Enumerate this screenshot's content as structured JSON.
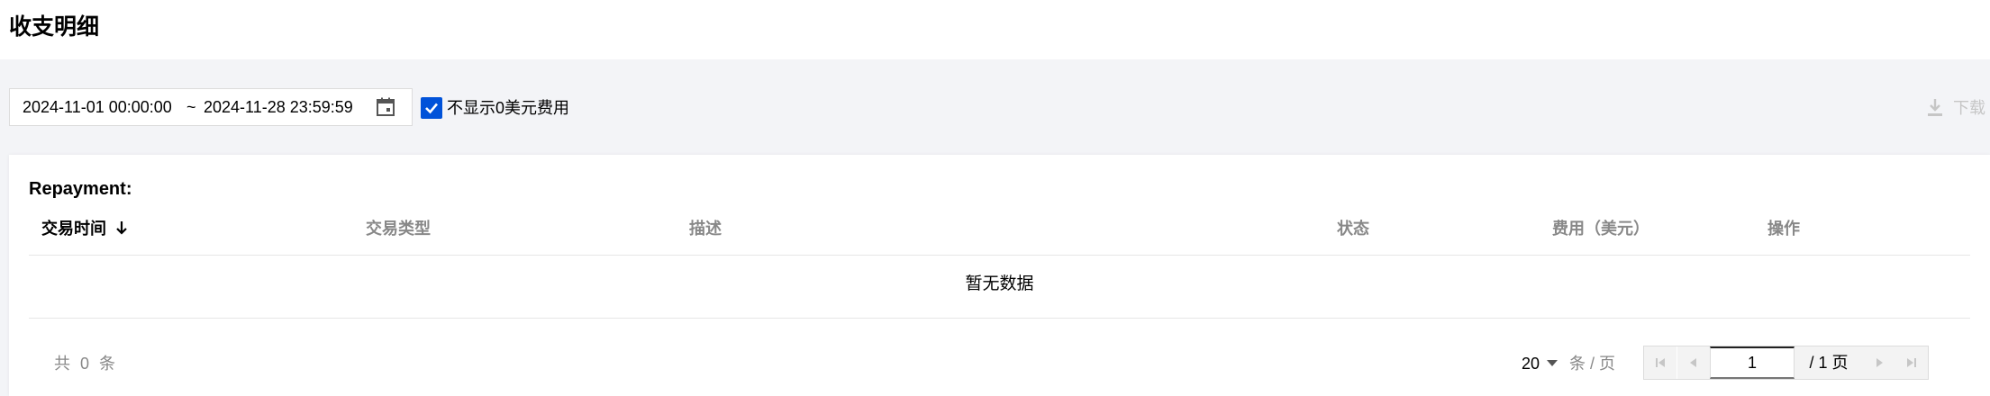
{
  "header": {
    "title": "收支明细"
  },
  "toolbar": {
    "date_start": "2024-11-01 00:00:00",
    "date_separator": "~",
    "date_end": "2024-11-28 23:59:59",
    "checkbox_label": "不显示0美元费用",
    "checkbox_checked": true,
    "download_label": "下载"
  },
  "table": {
    "section_title": "Repayment:",
    "columns": [
      "交易时间",
      "交易类型",
      "描述",
      "状态",
      "费用（美元）",
      "操作"
    ],
    "sorted_column": "交易时间",
    "empty_text": "暂无数据"
  },
  "pagination": {
    "total_text": "共 0 条",
    "page_size": "20",
    "per_page_label": "条 / 页",
    "current_page": "1",
    "total_pages_text": "/ 1 页"
  },
  "colors": {
    "accent": "#0052d9",
    "background": "#f3f4f7",
    "muted_text": "#888888",
    "disabled": "#c6c6c6"
  }
}
